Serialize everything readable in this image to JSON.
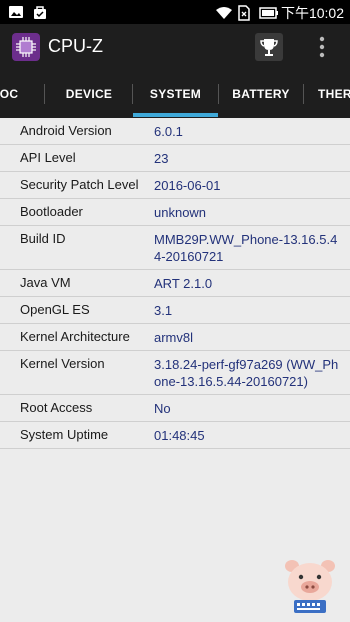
{
  "status_bar": {
    "time": "下午10:02",
    "left_icons": [
      "photo-icon",
      "bag-icon"
    ],
    "right_icons": [
      "wifi-icon",
      "sim-icon",
      "battery-icon"
    ]
  },
  "app_bar": {
    "title": "CPU-Z",
    "logo_icon": "cpu-z-logo-icon",
    "actions": [
      "trophy-icon",
      "overflow-menu-icon"
    ]
  },
  "tabs": [
    {
      "label": "OC"
    },
    {
      "label": "DEVICE"
    },
    {
      "label": "SYSTEM",
      "active": true
    },
    {
      "label": "BATTERY"
    },
    {
      "label": "THER"
    }
  ],
  "accent_color": "#3fa9d9",
  "value_color": "#23327a",
  "system_info": [
    {
      "label": "Android Version",
      "value": "6.0.1"
    },
    {
      "label": "API Level",
      "value": "23"
    },
    {
      "label": "Security Patch Level",
      "value": "2016-06-01"
    },
    {
      "label": "Bootloader",
      "value": "unknown"
    },
    {
      "label": "Build ID",
      "value": "MMB29P.WW_Phone-13.16.5.44-20160721"
    },
    {
      "label": "Java VM",
      "value": "ART 2.1.0"
    },
    {
      "label": "OpenGL ES",
      "value": "3.1"
    },
    {
      "label": "Kernel Architecture",
      "value": "armv8l"
    },
    {
      "label": "Kernel Version",
      "value": "3.18.24-perf-gf97a269 (WW_Phone-13.16.5.44-20160721)"
    },
    {
      "label": "Root Access",
      "value": "No"
    },
    {
      "label": "System Uptime",
      "value": "01:48:45"
    }
  ]
}
